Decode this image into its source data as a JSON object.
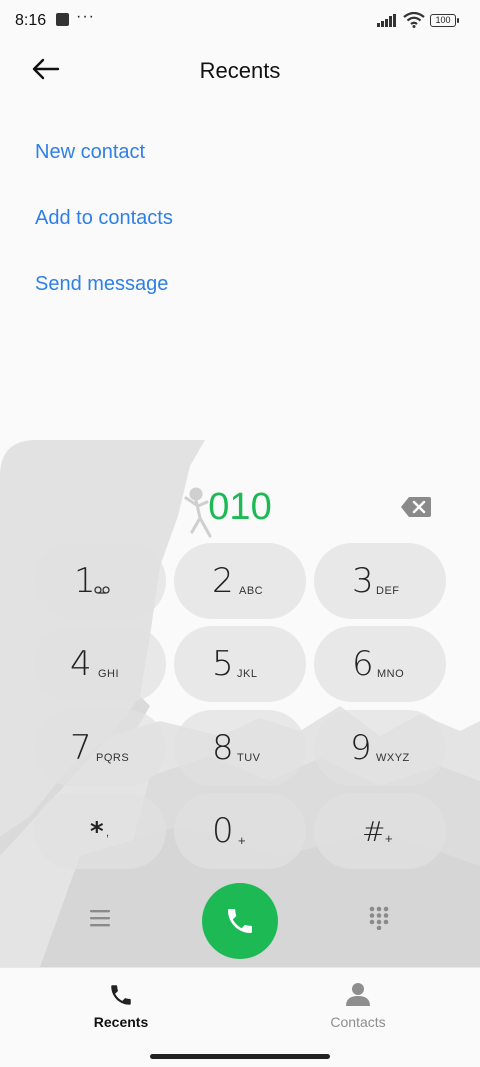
{
  "status_bar": {
    "time": "8:16",
    "overflow": "···",
    "battery": "100"
  },
  "header": {
    "title": "Recents"
  },
  "actions": [
    {
      "label": "New contact"
    },
    {
      "label": "Add to contacts"
    },
    {
      "label": "Send message"
    }
  ],
  "dialer": {
    "number": "010",
    "keys": [
      {
        "digit": "1",
        "letters": ""
      },
      {
        "digit": "2",
        "letters": "ABC"
      },
      {
        "digit": "3",
        "letters": "DEF"
      },
      {
        "digit": "4",
        "letters": "GHI"
      },
      {
        "digit": "5",
        "letters": "JKL"
      },
      {
        "digit": "6",
        "letters": "MNO"
      },
      {
        "digit": "7",
        "letters": "PQRS"
      },
      {
        "digit": "8",
        "letters": "TUV"
      },
      {
        "digit": "9",
        "letters": "WXYZ"
      },
      {
        "digit": "*",
        "letters": ","
      },
      {
        "digit": "0",
        "letters": "+"
      },
      {
        "digit": "#",
        "letters": "+"
      }
    ]
  },
  "nav": {
    "recents": "Recents",
    "contacts": "Contacts"
  },
  "colors": {
    "accent_blue": "#2f7fe8",
    "call_green": "#1db954"
  },
  "icons": [
    "back-arrow-icon",
    "backspace-icon",
    "voicemail-icon",
    "menu-icon",
    "phone-icon",
    "dialpad-icon",
    "person-icon"
  ]
}
